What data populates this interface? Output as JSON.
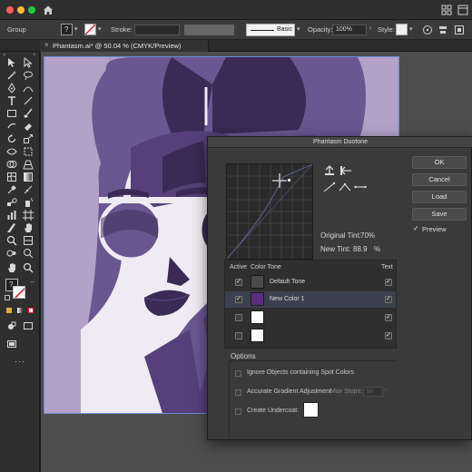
{
  "app": {
    "context_label": "Group",
    "window_controls": [
      "close",
      "minimize",
      "zoom"
    ]
  },
  "control_bar": {
    "stroke_label": "Stroke:",
    "brush_label": "Basic",
    "opacity_label": "Opacity:",
    "opacity_value": "100%",
    "style_label": "Style:",
    "fill_glyph": "?"
  },
  "document": {
    "tab_title": "Phantasm.ai* @ 50.04 % (CMYK/Preview)",
    "close_glyph": "×"
  },
  "dialog": {
    "title": "Phantasm Duotone",
    "original_tint_label": "Original Tint:",
    "original_tint_value": "70%",
    "new_tint_label": "New Tint:",
    "new_tint_value": "88.9",
    "new_tint_unit": "%",
    "buttons": {
      "ok": "OK",
      "cancel": "Cancel",
      "load": "Load",
      "save": "Save"
    },
    "preview_label": "Preview",
    "preview_checked": true,
    "table": {
      "headers": {
        "active": "Active",
        "color_tone": "Color Tone",
        "text": "Text"
      },
      "rows": [
        {
          "active": true,
          "swatch": "#4a4a4a",
          "tone": "Default Tone",
          "text": true
        },
        {
          "active": true,
          "swatch": "#5a2d7e",
          "tone": "New Color 1",
          "text": true
        },
        {
          "active": false,
          "swatch": "#ffffff",
          "tone": "",
          "text": true
        },
        {
          "active": false,
          "swatch": "#ffffff",
          "tone": "",
          "text": true
        }
      ]
    },
    "options": {
      "title": "Options",
      "ignore_spot": "Ignore Objects containing Spot Colors",
      "accurate_gradient": "Accurate Gradient Adjustment",
      "max_stops_label": "Max Stops:",
      "max_stops_value": "50",
      "undercoat": "Create Undercoat:",
      "undercoat_color": "#ffffff"
    }
  },
  "colors": {
    "art_light": "#b3a1c8",
    "art_mid": "#6a5690",
    "art_dark": "#3a2a55",
    "art_skin": "#efebf2",
    "art_shadow": "#57407a"
  }
}
